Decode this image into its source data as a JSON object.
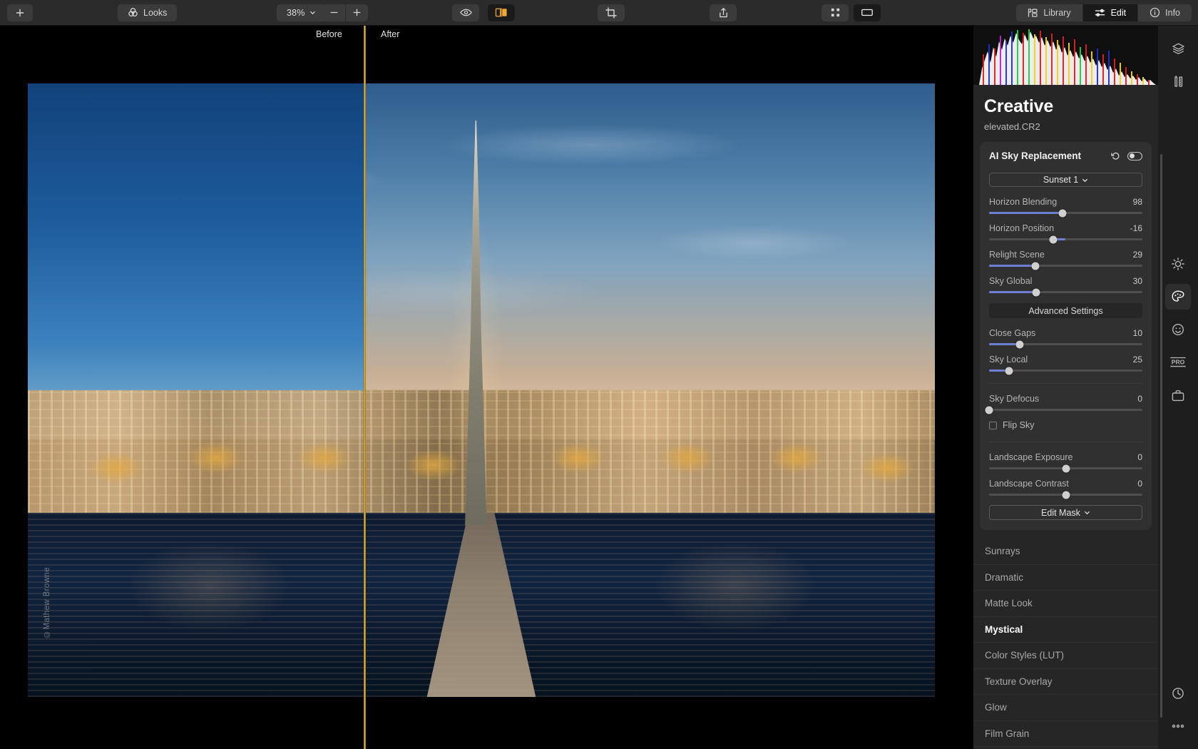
{
  "toolbar": {
    "add_label": "+",
    "looks_label": "Looks",
    "zoom_value": "38%",
    "zoom_out_label": "−",
    "zoom_in_label": "+",
    "icons": {
      "looks": "venn-icon",
      "preview": "eye-icon",
      "compare": "split-compare-icon",
      "crop": "crop-icon",
      "share": "share-icon",
      "grid": "grid-icon",
      "single": "single-view-icon"
    },
    "tabs": [
      {
        "label": "Library",
        "icon": "library-icon",
        "active": false
      },
      {
        "label": "Edit",
        "icon": "sliders-icon",
        "active": true
      },
      {
        "label": "Info",
        "icon": "info-icon",
        "active": false
      }
    ]
  },
  "compare": {
    "before_label": "Before",
    "after_label": "After"
  },
  "canvas": {
    "watermark": "©Mathew Browne"
  },
  "panel": {
    "title": "Creative",
    "filename": "elevated.CR2",
    "accent_slider": "#6f7fd4",
    "accent_divider": "#d9a92e",
    "card": {
      "title": "AI Sky Replacement",
      "reset_icon": "reset-icon",
      "toggle_icon": "toggle-on-icon",
      "preset": "Sunset 1",
      "advanced_settings_label": "Advanced Settings",
      "edit_mask_label": "Edit Mask",
      "flip_sky_label": "Flip Sky",
      "flip_sky_checked": false,
      "sliders_primary": [
        {
          "label": "Horizon Blending",
          "value": "98",
          "pct": 48,
          "fillpct": 48
        },
        {
          "label": "Horizon Position",
          "value": "-16",
          "pct": 42,
          "fillpct": 0,
          "center": true
        },
        {
          "label": "Relight Scene",
          "value": "29",
          "pct": 30,
          "fillpct": 30
        },
        {
          "label": "Sky Global",
          "value": "30",
          "pct": 30.5,
          "fillpct": 30.5
        }
      ],
      "sliders_advanced": [
        {
          "label": "Close Gaps",
          "value": "10",
          "pct": 20,
          "fillpct": 20
        },
        {
          "label": "Sky Local",
          "value": "25",
          "pct": 13,
          "fillpct": 13
        }
      ],
      "sliders_defocus": [
        {
          "label": "Sky Defocus",
          "value": "0",
          "pct": 0,
          "fillpct": 0
        }
      ],
      "sliders_landscape": [
        {
          "label": "Landscape Exposure",
          "value": "0",
          "pct": 50,
          "fillpct": 0,
          "center": true
        },
        {
          "label": "Landscape Contrast",
          "value": "0",
          "pct": 50,
          "fillpct": 0,
          "center": true
        }
      ]
    },
    "looks": [
      {
        "label": "Sunrays",
        "selected": false
      },
      {
        "label": "Dramatic",
        "selected": false
      },
      {
        "label": "Matte Look",
        "selected": false
      },
      {
        "label": "Mystical",
        "selected": true
      },
      {
        "label": "Color Styles (LUT)",
        "selected": false
      },
      {
        "label": "Texture Overlay",
        "selected": false
      },
      {
        "label": "Glow",
        "selected": false
      },
      {
        "label": "Film Grain",
        "selected": false
      }
    ]
  },
  "rail": {
    "top_icons": [
      {
        "name": "layers-icon",
        "active": false
      },
      {
        "name": "tools-icon",
        "active": false
      }
    ],
    "mid_icons": [
      {
        "name": "sun-icon",
        "active": false
      },
      {
        "name": "palette-icon",
        "active": true
      },
      {
        "name": "portrait-icon",
        "active": false
      },
      {
        "name": "pro-icon",
        "active": false
      },
      {
        "name": "briefcase-icon",
        "active": false
      }
    ],
    "bottom_icons": [
      {
        "name": "history-clock-icon",
        "active": false
      },
      {
        "name": "more-dots-icon",
        "active": false
      }
    ]
  }
}
